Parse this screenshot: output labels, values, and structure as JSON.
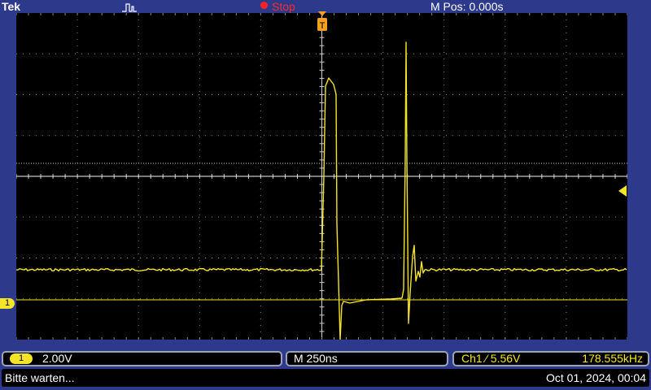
{
  "header": {
    "brand": "Tek",
    "acquisition_icon": "pulse-icon",
    "run_state": "Stop",
    "horizontal_position": "M Pos: 0.000s"
  },
  "display": {
    "trigger_position_marker": "T",
    "channel_marker": "1",
    "trace_color": "#f5e52a",
    "background_color": "#000000",
    "grid_color": "#8a8a8a"
  },
  "readouts": {
    "channel_badge": "1",
    "vertical_scale": "2.00V",
    "timebase": "M 250ns",
    "trigger": "Ch1 ⁄ 5.56V",
    "frequency": "178.555kHz"
  },
  "status": {
    "message": "Bitte warten...",
    "datetime": "Oct 01, 2024, 00:04"
  }
}
